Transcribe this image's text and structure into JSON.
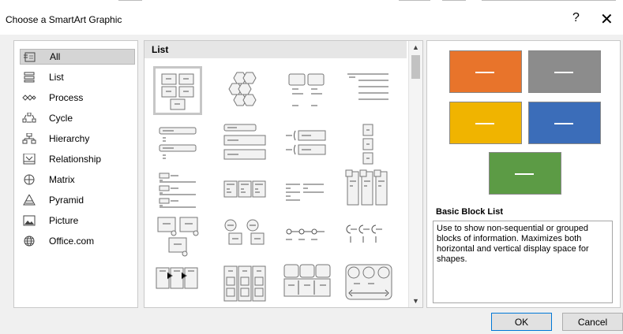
{
  "dialog": {
    "title": "Choose a SmartArt Graphic",
    "help": "?",
    "close": "✕"
  },
  "categories": [
    {
      "label": "All",
      "icon": "all-icon",
      "selected": true
    },
    {
      "label": "List",
      "icon": "list-icon"
    },
    {
      "label": "Process",
      "icon": "process-icon"
    },
    {
      "label": "Cycle",
      "icon": "cycle-icon"
    },
    {
      "label": "Hierarchy",
      "icon": "hierarchy-icon"
    },
    {
      "label": "Relationship",
      "icon": "relationship-icon"
    },
    {
      "label": "Matrix",
      "icon": "matrix-icon"
    },
    {
      "label": "Pyramid",
      "icon": "pyramid-icon"
    },
    {
      "label": "Picture",
      "icon": "picture-icon"
    },
    {
      "label": "Office.com",
      "icon": "globe-icon"
    }
  ],
  "gallery": {
    "header": "List",
    "selected_index": 0
  },
  "preview": {
    "colors": [
      "#e8742b",
      "#8c8c8c",
      "#f0b400",
      "#3b6db9",
      "#5c9b45"
    ],
    "name": "Basic Block List",
    "description": "Use to show non-sequential or grouped blocks of information. Maximizes both horizontal and vertical display space for shapes."
  },
  "buttons": {
    "ok": "OK",
    "cancel": "Cancel"
  }
}
